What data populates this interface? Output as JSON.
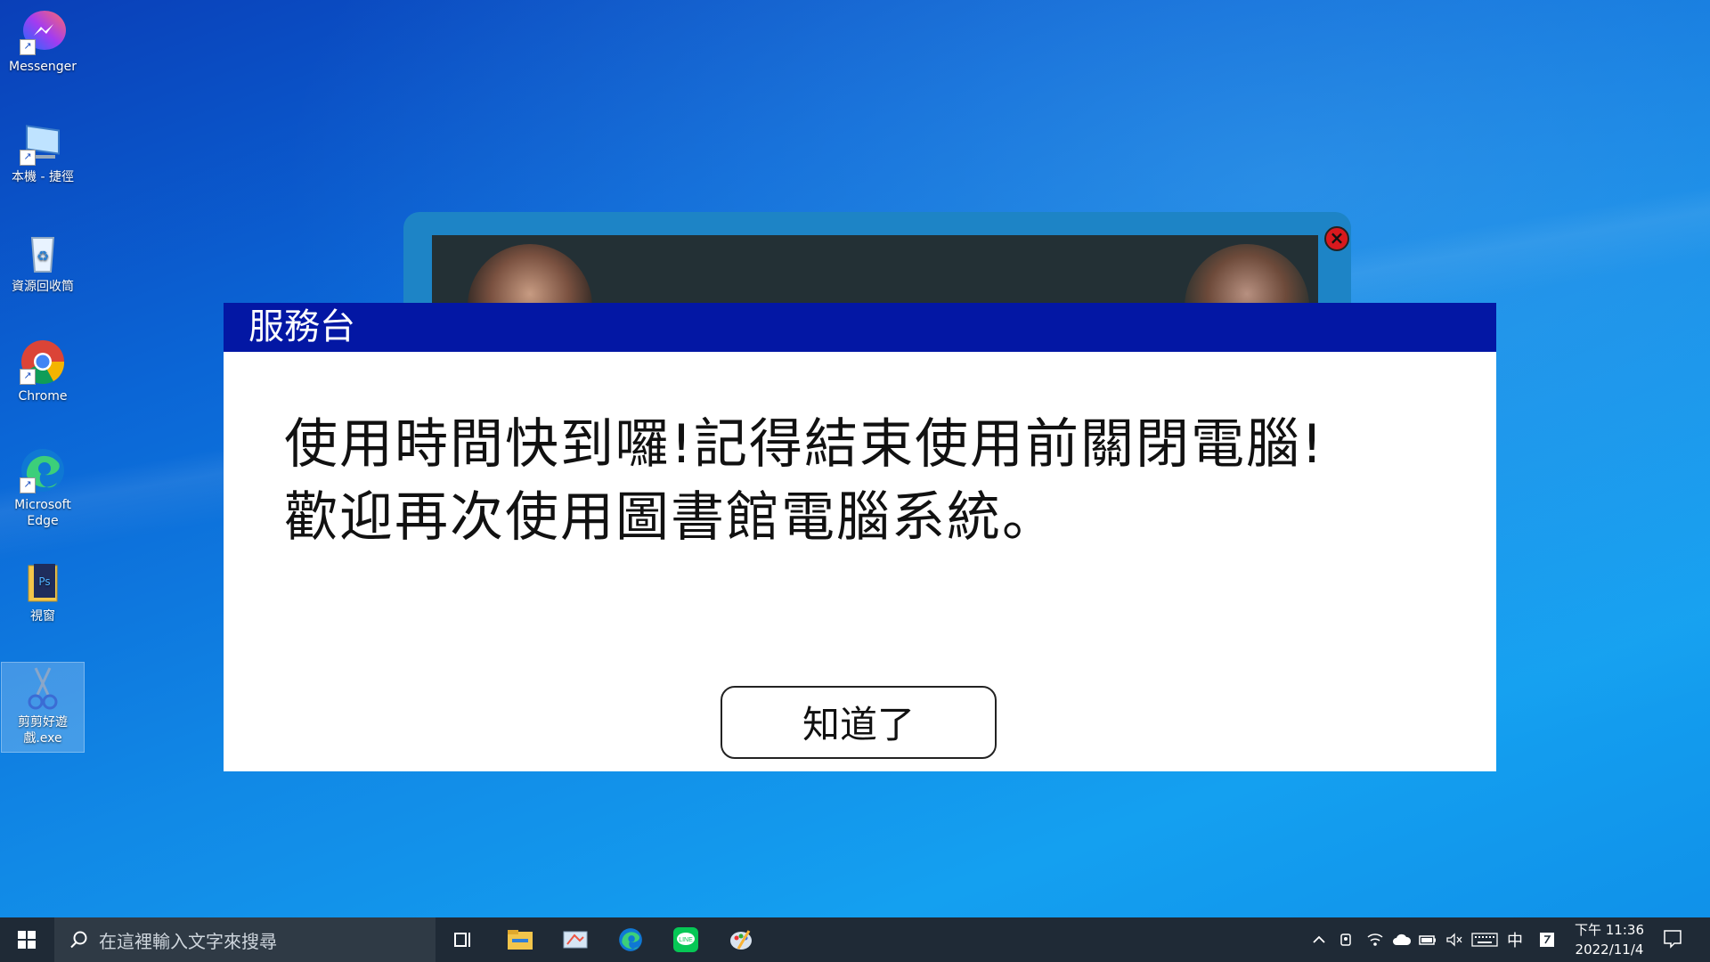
{
  "desktop": {
    "icons": [
      {
        "label": "Messenger",
        "icon": "messenger-icon"
      },
      {
        "label": "本機 - 捷徑",
        "icon": "computer-icon"
      },
      {
        "label": "資源回收筒",
        "icon": "recycle-bin-icon"
      },
      {
        "label": "Chrome",
        "icon": "chrome-icon"
      },
      {
        "label": "Microsoft Edge",
        "icon": "edge-icon"
      },
      {
        "label": "視窗",
        "icon": "folder-icon"
      },
      {
        "label": "剪剪好遊戲.exe",
        "icon": "scissors-icon"
      }
    ]
  },
  "dialog": {
    "title": "服務台",
    "message_line1": "使用時間快到囉!記得結束使用前關閉電腦!",
    "message_line2": "歡迎再次使用圖書館電腦系統。",
    "ok_label": "知道了"
  },
  "taskbar": {
    "search_placeholder": "在這裡輸入文字來搜尋",
    "ime_label": "中",
    "time": "下午 11:36",
    "date": "2022/11/4"
  },
  "colors": {
    "dialog_title_bg": "#0317a4",
    "taskbar_bg": "#1f2a36",
    "close_button": "#d9191e"
  }
}
